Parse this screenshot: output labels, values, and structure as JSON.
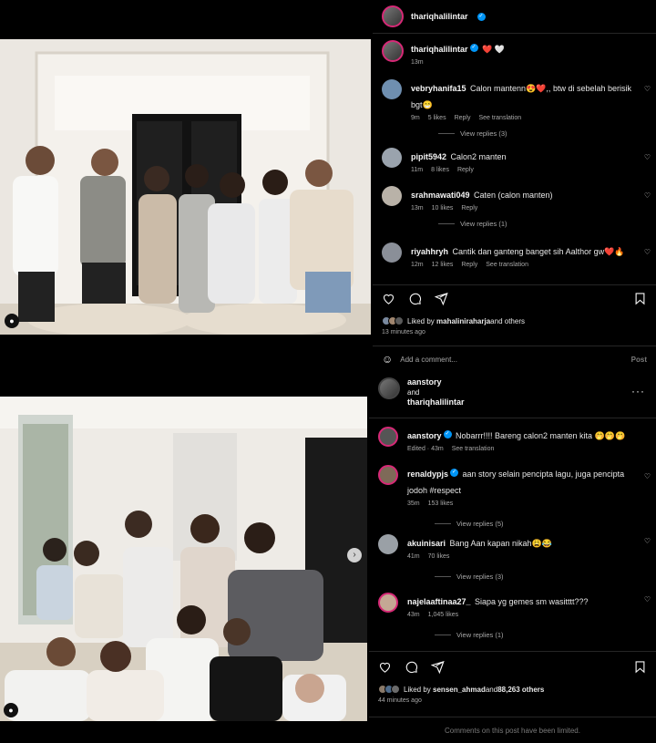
{
  "post1": {
    "username": "thariqhalilintar",
    "caption_tail": "❤️ 🤍",
    "caption_time": "13m",
    "comments": [
      {
        "user": "vebryhanifa15",
        "text": "Calon mantenn😍❤️,, btw di sebelah berisik bgt😁",
        "time": "9m",
        "likes": "5 likes",
        "reply": "Reply",
        "extra": "See translation",
        "view": "View replies (3)"
      },
      {
        "user": "pipit5942",
        "text": "Calon2 manten",
        "time": "11m",
        "likes": "8 likes",
        "reply": "Reply",
        "extra": "",
        "view": ""
      },
      {
        "user": "srahmawati049",
        "text": "Caten (calon manten)",
        "time": "13m",
        "likes": "10 likes",
        "reply": "Reply",
        "extra": "",
        "view": "View replies (1)"
      },
      {
        "user": "riyahhryh",
        "text": "Cantik dan ganteng banget sih Aalthor gw❤️🔥",
        "time": "12m",
        "likes": "12 likes",
        "reply": "Reply",
        "extra": "See translation",
        "view": ""
      }
    ],
    "liked_by_prefix": "Liked by ",
    "liked_by_user": "mahaliniraharja",
    "liked_by_suffix": " and others",
    "ago": "13 minutes ago",
    "add_comment": "Add a comment...",
    "post_label": "Post"
  },
  "post2": {
    "user1": "aanstory",
    "and": "and",
    "user2": "thariqhalilintar",
    "comments": [
      {
        "user": "aanstory",
        "text": "Nobarrr!!!! Bareng calon2 manten kita 🤭🤭🤭",
        "time": "Edited · 43m",
        "likes": "",
        "reply": "",
        "extra": "See translation",
        "view": ""
      },
      {
        "user": "renaldypjs",
        "text": "aan story selain pencipta lagu, juga pencipta jodoh #respect",
        "time": "35m",
        "likes": "153 likes",
        "reply": "",
        "extra": "",
        "view": "View replies (5)"
      },
      {
        "user": "akuinisari",
        "text": "Bang Aan kapan nikah😩😂",
        "time": "41m",
        "likes": "70 likes",
        "reply": "",
        "extra": "",
        "view": "View replies (3)"
      },
      {
        "user": "najelaaftinaa27_",
        "text": "Siapa yg gemes sm wasitttt???",
        "time": "43m",
        "likes": "1,045 likes",
        "reply": "",
        "extra": "",
        "view": "View replies (1)"
      }
    ],
    "liked_by_prefix": "Liked by ",
    "liked_by_user": "sensen_ahmad",
    "liked_by_mid": " and ",
    "liked_by_count": "88,263 others",
    "ago": "44 minutes ago",
    "limited": "Comments on this post have been limited."
  },
  "colors": {
    "verified": "#0095f6",
    "bg": "#000000",
    "muted": "#a8a8a8"
  },
  "icons": [
    "heart-icon",
    "comment-icon",
    "share-icon",
    "bookmark-icon",
    "emoji-icon",
    "more-icon",
    "next-arrow-icon",
    "user-tag-icon"
  ]
}
